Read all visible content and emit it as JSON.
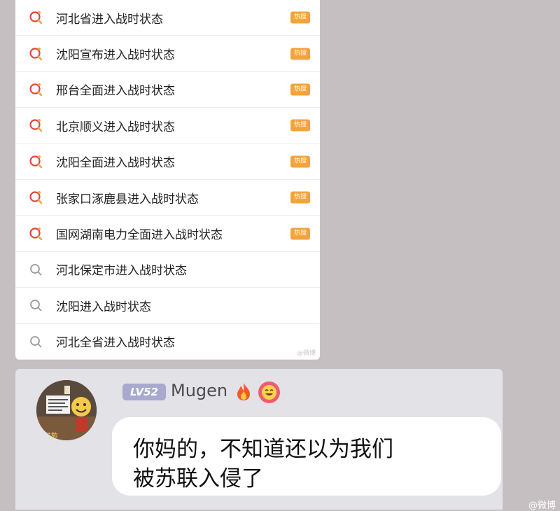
{
  "search_suggestions": [
    {
      "text": "河北省进入战时状态",
      "hot": true,
      "badge": "热搜",
      "icon": "hot-search-icon"
    },
    {
      "text": "沈阳宣布进入战时状态",
      "hot": true,
      "badge": "热搜",
      "icon": "hot-search-icon"
    },
    {
      "text": "邢台全面进入战时状态",
      "hot": true,
      "badge": "热搜",
      "icon": "hot-search-icon"
    },
    {
      "text": "北京顺义进入战时状态",
      "hot": true,
      "badge": "热搜",
      "icon": "hot-search-icon"
    },
    {
      "text": "沈阳全面进入战时状态",
      "hot": true,
      "badge": "热搜",
      "icon": "hot-search-icon"
    },
    {
      "text": "张家口涿鹿县进入战时状态",
      "hot": true,
      "badge": "热搜",
      "icon": "hot-search-icon"
    },
    {
      "text": "国网湖南电力全面进入战时状态",
      "hot": true,
      "badge": "热搜",
      "icon": "hot-search-icon"
    },
    {
      "text": "河北保定市进入战时状态",
      "hot": false,
      "icon": "search-icon"
    },
    {
      "text": "沈阳进入战时状态",
      "hot": false,
      "icon": "search-icon"
    },
    {
      "text": "河北全省进入战时状态",
      "hot": false,
      "icon": "search-icon"
    }
  ],
  "panel_watermark": "@微博",
  "chat": {
    "level": "LV52",
    "username": "Mugen",
    "avatar_caption": "共勉",
    "message_lines": [
      "你妈的，不知道还以为我们",
      "被苏联入侵了"
    ],
    "fire_icon": "fire-icon",
    "emoji_icon": "smiling-face-icon"
  },
  "corner_watermark": "@微博",
  "colors": {
    "background": "#c5bfc2",
    "hot_badge": "#f2a43a",
    "hot_icon_red": "#e0463b",
    "hot_icon_orange": "#f0a43b",
    "level_badge": "#a9a8cf",
    "chat_panel": "#e2e2e7"
  }
}
